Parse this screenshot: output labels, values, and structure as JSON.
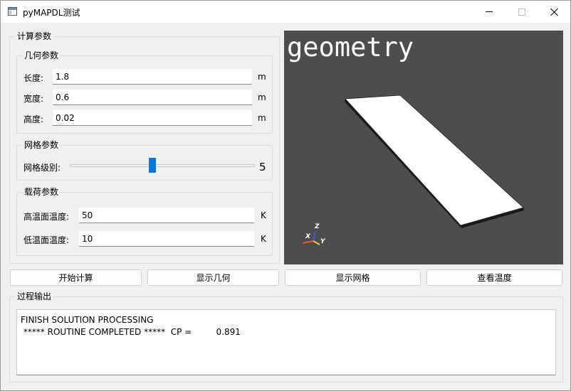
{
  "window": {
    "title": "pyMAPDL测试",
    "controls": {
      "minimize": "minimize",
      "maximize": "maximize",
      "close": "close"
    }
  },
  "params": {
    "title": "计算参数",
    "geometry": {
      "title": "几何参数",
      "length_label": "长度:",
      "length_value": "1.8",
      "length_unit": "m",
      "width_label": "宽度:",
      "width_value": "0.6",
      "width_unit": "m",
      "height_label": "高度:",
      "height_value": "0.02",
      "height_unit": "m"
    },
    "mesh": {
      "title": "网格参数",
      "level_label": "网格级别:",
      "level_value": "5",
      "level_fraction": 0.45
    },
    "load": {
      "title": "载荷参数",
      "high_temp_label": "高温面温度:",
      "high_temp_value": "50",
      "high_temp_unit": "K",
      "low_temp_label": "低温面温度:",
      "low_temp_value": "10",
      "low_temp_unit": "K"
    }
  },
  "viewport": {
    "title": "geometry",
    "background": "#4d4d4d",
    "axis_labels": {
      "x": "X",
      "y": "Y",
      "z": "Z"
    },
    "axis_colors": {
      "x": "#e05a3a",
      "y": "#e8d23a",
      "z": "#3a5ae0"
    }
  },
  "buttons": {
    "start": "开始计算",
    "show_geometry": "显示几何",
    "show_mesh": "显示网格",
    "view_temperature": "查看温度"
  },
  "output": {
    "title": "过程输出",
    "lines": [
      "FINISH SOLUTION PROCESSING",
      "",
      "",
      " ***** ROUTINE COMPLETED *****  CP =         0.891"
    ]
  }
}
